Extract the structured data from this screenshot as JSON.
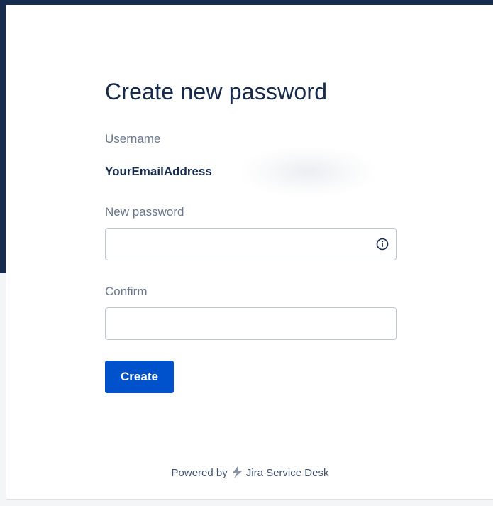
{
  "form": {
    "title": "Create new password",
    "username_label": "Username",
    "username_value": "YourEmailAddress",
    "new_password_label": "New password",
    "new_password_value": "",
    "confirm_label": "Confirm",
    "confirm_value": "",
    "create_button_label": "Create"
  },
  "footer": {
    "powered_by": "Powered by",
    "product_name": "Jira Service Desk",
    "logo_icon": "jira-service-desk-logo-icon"
  },
  "colors": {
    "header_band": "#172b4d",
    "primary_button": "#0052cc",
    "logo": "#8993a4"
  }
}
